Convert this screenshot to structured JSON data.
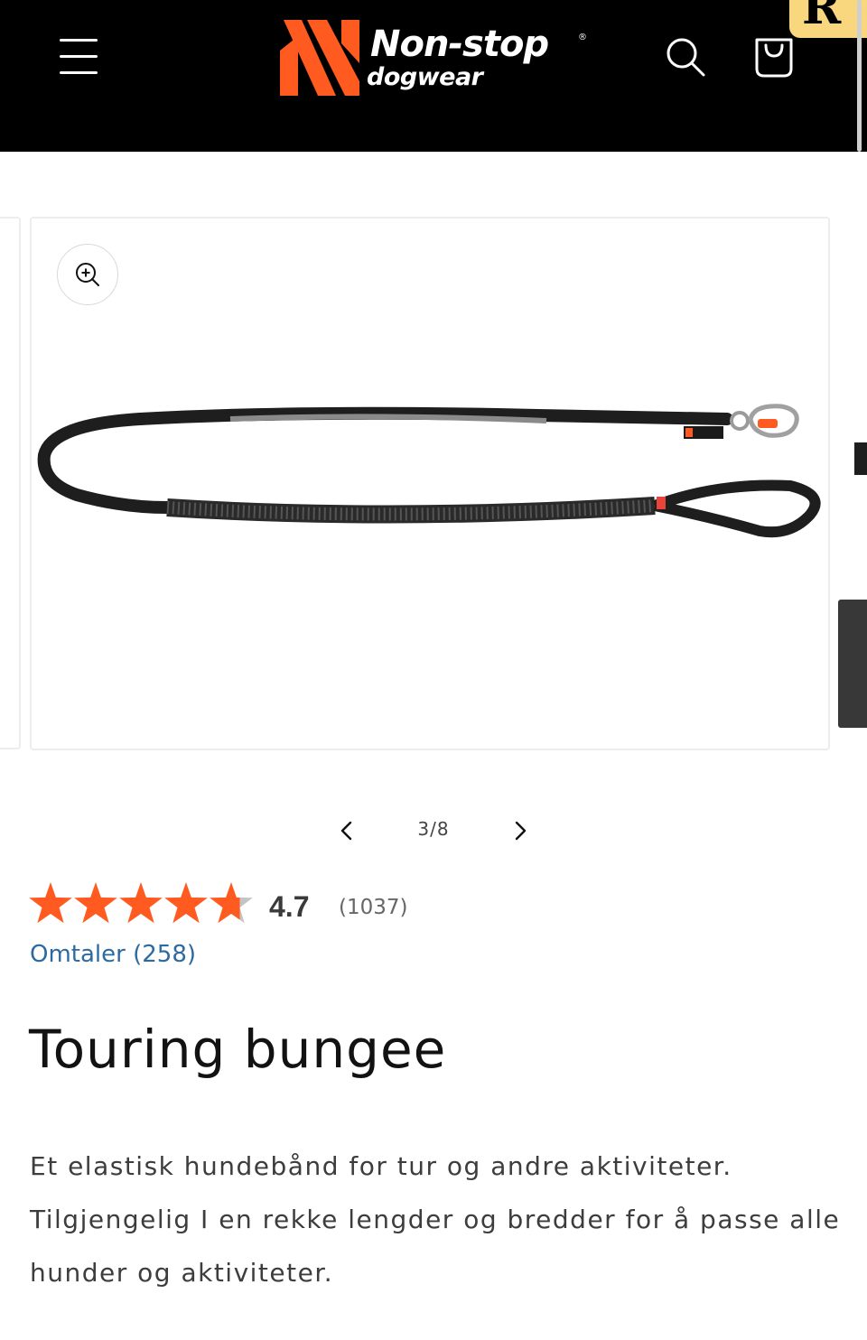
{
  "header": {
    "logo": {
      "line1": "Non-stop",
      "line2": "dogwear",
      "registered": "®",
      "mark_color": "#ff5a1f"
    },
    "menu_icon": "hamburger-menu-icon",
    "search_icon": "search-icon",
    "cart_icon": "shopping-bag-icon",
    "badge_glyph": "R",
    "background": "#000000"
  },
  "gallery": {
    "zoom_icon": "zoom-in-icon",
    "current": 3,
    "total": 8,
    "counter_text": "3/8",
    "prev_icon": "chevron-left-icon",
    "next_icon": "chevron-right-icon"
  },
  "rating": {
    "score": 0.94,
    "value_text": "4.7",
    "count_text": "(1037)",
    "star_color": "#ff5a1f",
    "empty_star_color": "#c4c4c4"
  },
  "reviews": {
    "link_text": "Omtaler (258)"
  },
  "product": {
    "title": "Touring bungee",
    "description": "Et elastisk hundebånd for tur og andre aktiviteter. Tilgjengelig I en rekke lengder og bredder for å passe alle hunder og aktiviteter."
  }
}
